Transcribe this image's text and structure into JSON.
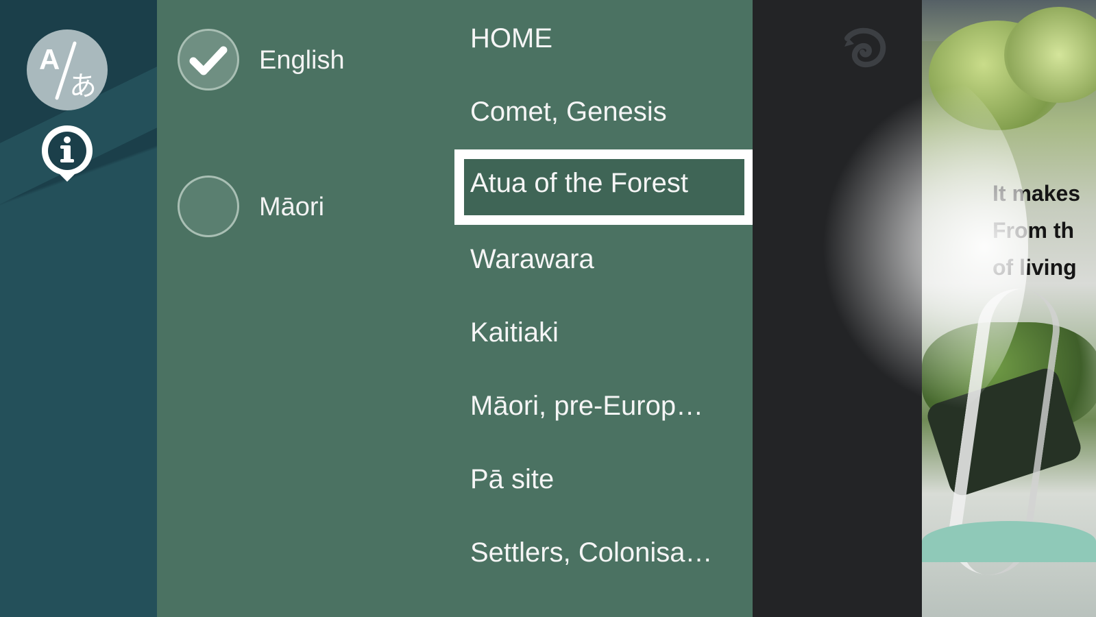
{
  "rail": {
    "language_button_icon": "language-translate-icon",
    "info_button_icon": "info-pin-icon"
  },
  "languages": [
    {
      "label": "English",
      "selected": true
    },
    {
      "label": "Māori",
      "selected": false
    }
  ],
  "menu": {
    "items": [
      "HOME",
      "Comet, Genesis",
      "Atua of the Forest",
      "Warawara",
      "Kaitiaki",
      "Māori, pre-Europ…",
      "Pā site",
      "Settlers, Colonisa…"
    ],
    "selected_index": 2
  },
  "header": {
    "koru_icon": "koru-spiral-icon"
  },
  "preview": {
    "lines": [
      "It makes",
      "From th",
      "of living"
    ]
  },
  "colors": {
    "panel": "#4b7262",
    "rail": "#1b3f4a",
    "dark": "#232426",
    "highlight": "#ffffff"
  }
}
